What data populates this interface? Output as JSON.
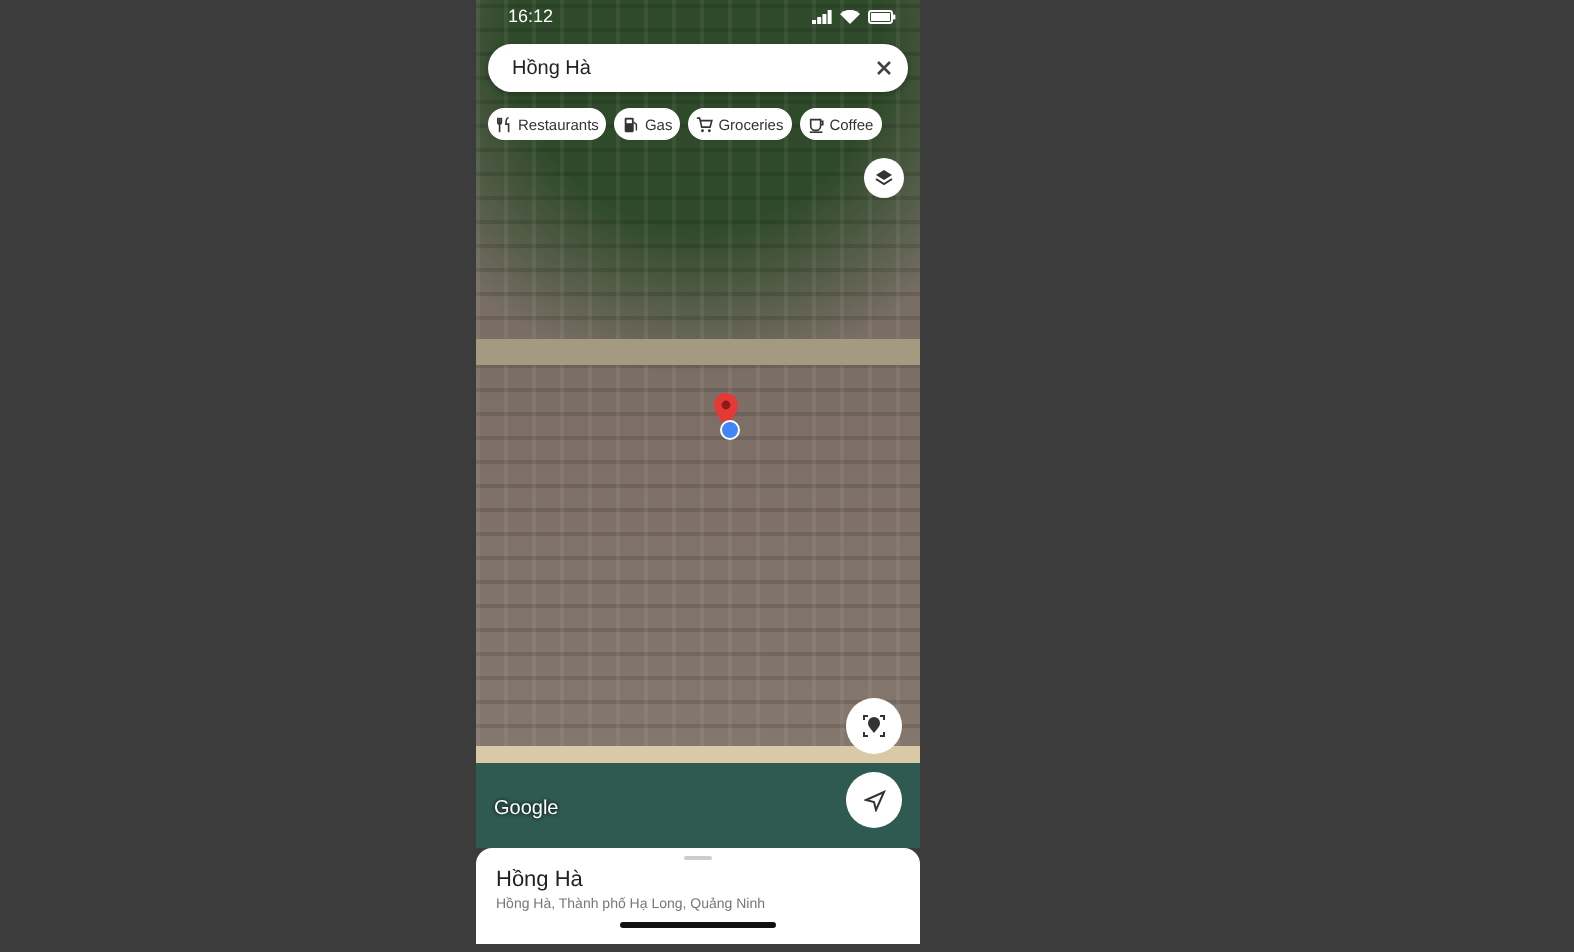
{
  "status_bar": {
    "time": "16:12"
  },
  "search": {
    "value": "Hồng Hà"
  },
  "chips": [
    {
      "kind": "restaurants",
      "label": "Restaurants"
    },
    {
      "kind": "gas",
      "label": "Gas"
    },
    {
      "kind": "groceries",
      "label": "Groceries"
    },
    {
      "kind": "coffee",
      "label": "Coffee"
    }
  ],
  "map": {
    "attribution": "Google"
  },
  "place": {
    "title": "Hồng Hà",
    "address": "Hồng Hà, Thành phố Hạ Long, Quảng Ninh"
  }
}
